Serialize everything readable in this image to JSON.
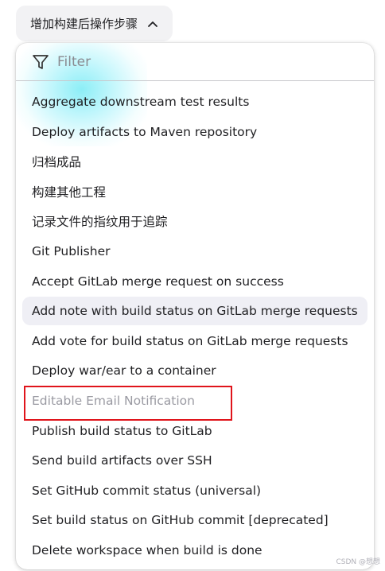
{
  "dropdown": {
    "label": "增加构建后操作步骤",
    "icon": "chevron-up-icon"
  },
  "filter": {
    "placeholder": "Filter",
    "value": "",
    "icon": "filter-icon"
  },
  "items": [
    {
      "label": "Aggregate downstream test results",
      "state": "normal"
    },
    {
      "label": "Deploy artifacts to Maven repository",
      "state": "normal"
    },
    {
      "label": "归档成品",
      "state": "normal"
    },
    {
      "label": "构建其他工程",
      "state": "normal"
    },
    {
      "label": "记录文件的指纹用于追踪",
      "state": "normal"
    },
    {
      "label": "Git Publisher",
      "state": "normal"
    },
    {
      "label": "Accept GitLab merge request on success",
      "state": "normal"
    },
    {
      "label": "Add note with build status on GitLab merge requests",
      "state": "hovered"
    },
    {
      "label": "Add vote for build status on GitLab merge requests",
      "state": "normal"
    },
    {
      "label": "Deploy war/ear to a container",
      "state": "normal"
    },
    {
      "label": "Editable Email Notification",
      "state": "disabled"
    },
    {
      "label": "Publish build status to GitLab",
      "state": "normal"
    },
    {
      "label": "Send build artifacts over SSH",
      "state": "normal"
    },
    {
      "label": "Set GitHub commit status (universal)",
      "state": "normal"
    },
    {
      "label": "Set build status on GitHub commit [deprecated]",
      "state": "normal"
    },
    {
      "label": "Delete workspace when build is done",
      "state": "normal"
    }
  ],
  "watermark": "CSDN @想想",
  "colors": {
    "highlight_border": "#e0141b",
    "hover_bg": "#efeff5",
    "disabled_text": "#9a9aa2"
  }
}
